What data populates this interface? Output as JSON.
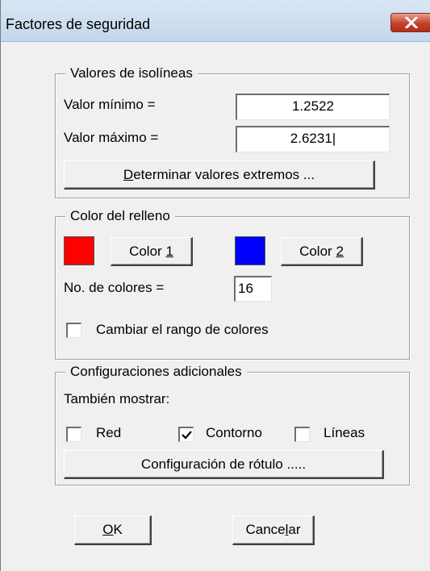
{
  "window": {
    "title": "Factores de seguridad",
    "close_icon": "close-x-icon"
  },
  "isolines": {
    "legend": "Valores de isolíneas",
    "min_label": "Valor mínimo =",
    "min_value": "1.2522",
    "max_label": "Valor máximo =",
    "max_value": "2.6231|",
    "determine_button_pre": "",
    "determine_button_accel": "D",
    "determine_button_post": "eterminar valores extremos ..."
  },
  "fill": {
    "legend": "Color del relleno",
    "color1_swatch": "#ff0000",
    "color1_button_pre": "Color ",
    "color1_button_accel": "1",
    "color2_swatch": "#0000ff",
    "color2_button_pre": "Color ",
    "color2_button_accel": "2",
    "num_colors_label": "No. de colores =",
    "num_colors_value": "16",
    "change_range_pre": "Cam",
    "change_range_accel": "b",
    "change_range_post": "iar el rango de colores",
    "change_range_checked": false
  },
  "additional": {
    "legend": "Configuraciones adicionales",
    "also_show_label": "También mostrar:",
    "red_accel": "R",
    "red_post": "ed",
    "red_checked": false,
    "contour_accel": "C",
    "contour_post": "ontorno",
    "contour_checked": true,
    "lines_pre": "Lí",
    "lines_accel": "n",
    "lines_post": "eas",
    "lines_checked": false,
    "label_config_pre": "Confi",
    "label_config_accel": "g",
    "label_config_post": "uración de rótulo ....."
  },
  "footer": {
    "ok_accel": "O",
    "ok_post": "K",
    "cancel_pre": "Cance",
    "cancel_accel": "l",
    "cancel_post": "ar"
  }
}
